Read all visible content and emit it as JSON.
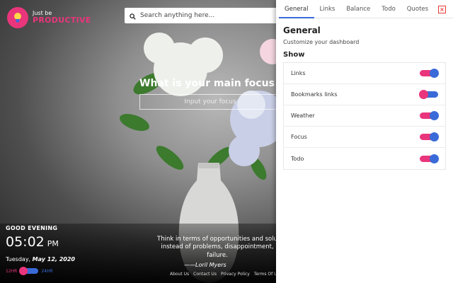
{
  "logo": {
    "small": "Just be",
    "big": "PRODUCTIVE"
  },
  "search": {
    "placeholder": "Search anything here..."
  },
  "focus": {
    "question": "What is your main focus for",
    "placeholder": "Input your focus"
  },
  "greeting": "GOOD EVENING",
  "clock": {
    "time": "05:02",
    "ampm": "PM"
  },
  "date": {
    "weekday": "Tuesday,",
    "rest": "May 12, 2020"
  },
  "hour_toggle": {
    "left": "12HR",
    "right": "24HR",
    "selected": "12HR"
  },
  "quote": {
    "text": "Think in terms of opportunities and solu... instead of problems, disappointment, failure.",
    "line1": "Think in terms of opportunities and solu",
    "line2": "instead of problems, disappointment,",
    "line3": "failure.",
    "author": "——Loril Myers"
  },
  "footer": {
    "about": "About Us",
    "contact": "Contact Us",
    "privacy": "Privacy Policy",
    "terms": "Terms Of Us"
  },
  "panel": {
    "tabs": [
      "General",
      "Links",
      "Balance",
      "Todo",
      "Quotes"
    ],
    "active_tab": "General",
    "close": "×",
    "title": "General",
    "subtitle": "Customize your dashboard",
    "show_heading": "Show",
    "options": [
      {
        "label": "Links",
        "enabled": true
      },
      {
        "label": "Bookmarks links",
        "enabled": false
      },
      {
        "label": "Weather",
        "enabled": true
      },
      {
        "label": "Focus",
        "enabled": true
      },
      {
        "label": "Todo",
        "enabled": true
      }
    ]
  },
  "colors": {
    "accent_pink": "#e9357b",
    "accent_blue": "#3a6ad8",
    "close_red": "#e53935"
  },
  "icons": {
    "logo": "lightbulb-icon",
    "search": "search-icon",
    "close": "close-icon"
  }
}
